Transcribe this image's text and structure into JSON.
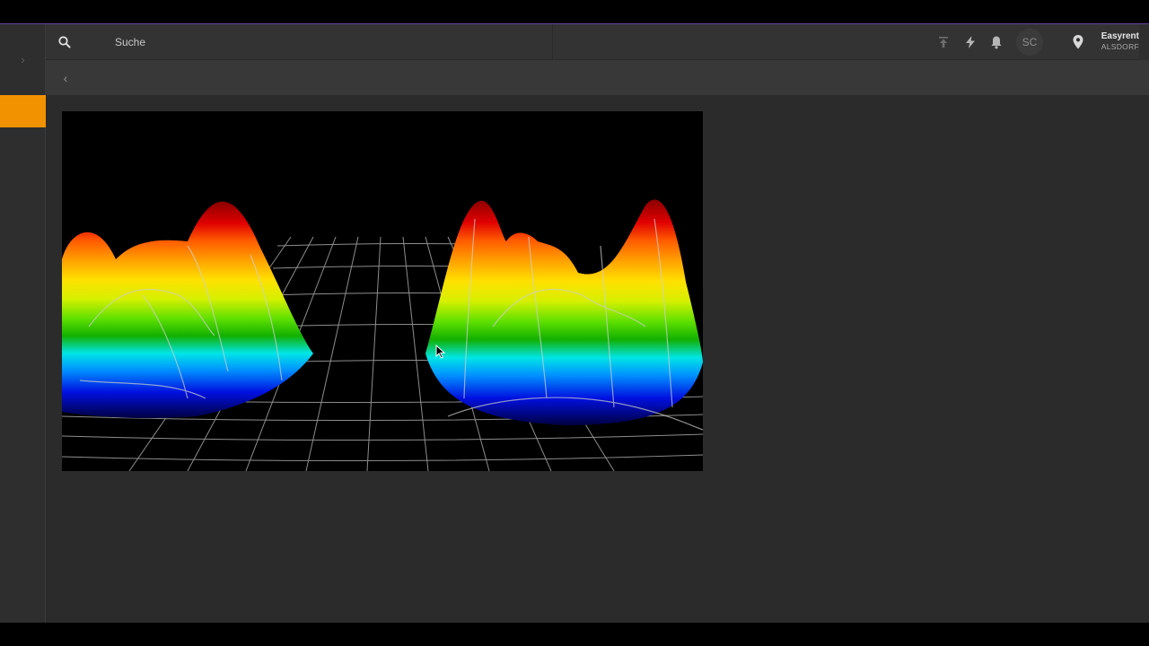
{
  "colors": {
    "accent_line": "#6a3fa0",
    "sidebar_active": "#f39200",
    "icon": "#9a9a9a",
    "icon_dim": "#6e6e6e"
  },
  "sidebar": {
    "toggle_icon": "chevron-right-icon",
    "toggle_glyph": "›"
  },
  "topbar": {
    "search": {
      "icon": "search-icon",
      "placeholder": "Suche"
    },
    "icons": [
      "upload-icon",
      "lightning-icon",
      "bell-icon"
    ],
    "avatar_initials": "SC",
    "location_icon": "location-pin-icon",
    "org_name": "Easyrent",
    "org_location": "ALSDORF"
  },
  "breadcrumb": {
    "back_icon": "chevron-left-icon",
    "back_glyph": "‹"
  },
  "media": {
    "type": "video-frame",
    "subject": "3d-surface-plot"
  }
}
